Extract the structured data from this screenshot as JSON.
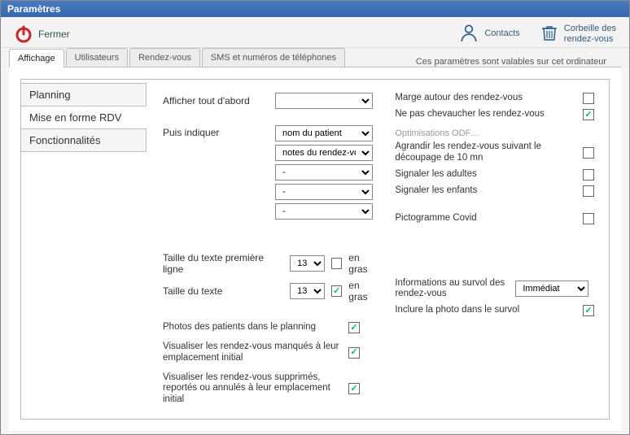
{
  "window": {
    "title": "Paramètres"
  },
  "toolbar": {
    "close_label": "Fermer",
    "contacts_label": "Contacts",
    "trash_line1": "Corbeille des",
    "trash_line2": "rendez-vous"
  },
  "tabs": {
    "items": [
      "Affichage",
      "Utilisateurs",
      "Rendez-vous",
      "SMS et numéros de téléphones"
    ],
    "note": "Ces paramètres sont valables sur cet ordinateur"
  },
  "sidenav": {
    "items": [
      "Planning",
      "Mise en forme RDV",
      "Fonctionnalités"
    ]
  },
  "left": {
    "afficher_tout": "Afficher tout d'abord",
    "afficher_tout_val": "",
    "puis_indiquer": "Puis indiquer",
    "sel1": "nom du patient",
    "sel2": "notes du rendez-vous",
    "dash": "-",
    "taille_premiere": "Taille du texte première ligne",
    "taille_premiere_val": "13",
    "taille_texte": "Taille du texte",
    "taille_texte_val": "13",
    "en_gras": "en gras",
    "photos_planning": "Photos des patients dans le planning",
    "visu_manques": "Visualiser les rendez-vous manqués à leur emplacement initial",
    "visu_supprimes": "Visualiser les rendez-vous supprimés, reportés ou annulés à leur emplacement initial"
  },
  "right": {
    "marge": "Marge autour des rendez-vous",
    "ne_pas_chevaucher": "Ne pas chevaucher les rendez-vous",
    "optim_title": "Optimisations ODF…",
    "agrandir": "Agrandir les rendez-vous suivant le découpage de 10 mn",
    "signaler_adultes": "Signaler les adultes",
    "signaler_enfants": "Signaler les enfants",
    "picto_covid": "Pictogramme Covid",
    "info_survol": "Informations au survol des rendez-vous",
    "info_survol_val": "Immédiat",
    "inclure_photo": "Inclure la photo dans le survol"
  }
}
